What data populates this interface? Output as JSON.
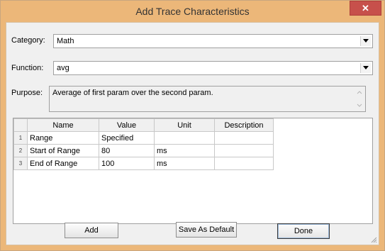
{
  "window": {
    "title": "Add Trace Characteristics",
    "close_label": "✕"
  },
  "category": {
    "label": "Category:",
    "value": "Math"
  },
  "function": {
    "label": "Function:",
    "value": "avg"
  },
  "purpose": {
    "label": "Purpose:",
    "value": "Average of first param over the second param."
  },
  "grid": {
    "columns": [
      "Name",
      "Value",
      "Unit",
      "Description"
    ],
    "rows": [
      {
        "num": "1",
        "name": "Range",
        "value": "Specified",
        "unit": "",
        "description": ""
      },
      {
        "num": "2",
        "name": "Start of Range",
        "value": "80",
        "unit": "ms",
        "description": ""
      },
      {
        "num": "3",
        "name": "End of Range",
        "value": "100",
        "unit": "ms",
        "description": ""
      }
    ]
  },
  "buttons": {
    "add": "Add",
    "save_default": "Save As Default",
    "done": "Done"
  }
}
